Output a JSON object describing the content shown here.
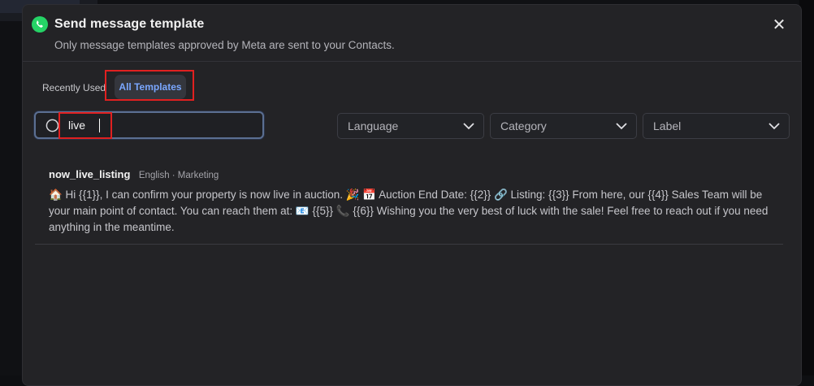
{
  "dialog": {
    "title": "Send message template",
    "subtitle": "Only message templates approved by Meta are sent to your Contacts.",
    "close_glyph": "✕"
  },
  "tabs": [
    {
      "label": "Recently Used",
      "active": false
    },
    {
      "label": "All Templates",
      "active": true
    }
  ],
  "search": {
    "value": "live",
    "icon": "search-icon"
  },
  "filters": {
    "language": "Language",
    "category": "Category",
    "label": "Label"
  },
  "templates": [
    {
      "name": "now_live_listing",
      "meta": "English · Marketing",
      "body": "🏠 Hi {{1}}, I can confirm your property is now live in auction. 🎉 📅 Auction End Date: {{2}} 🔗 Listing: {{3}} From here, our {{4}} Sales Team will be your main point of contact. You can reach them at: 📧 {{5}} 📞 {{6}} Wishing you the very best of luck with the sale! Feel free to reach out if you need anything in the meantime."
    }
  ],
  "colors": {
    "accent": "#7aa7ff",
    "whatsapp_green": "#25d366",
    "highlight_red": "#e02020",
    "modal_bg": "#232326"
  }
}
